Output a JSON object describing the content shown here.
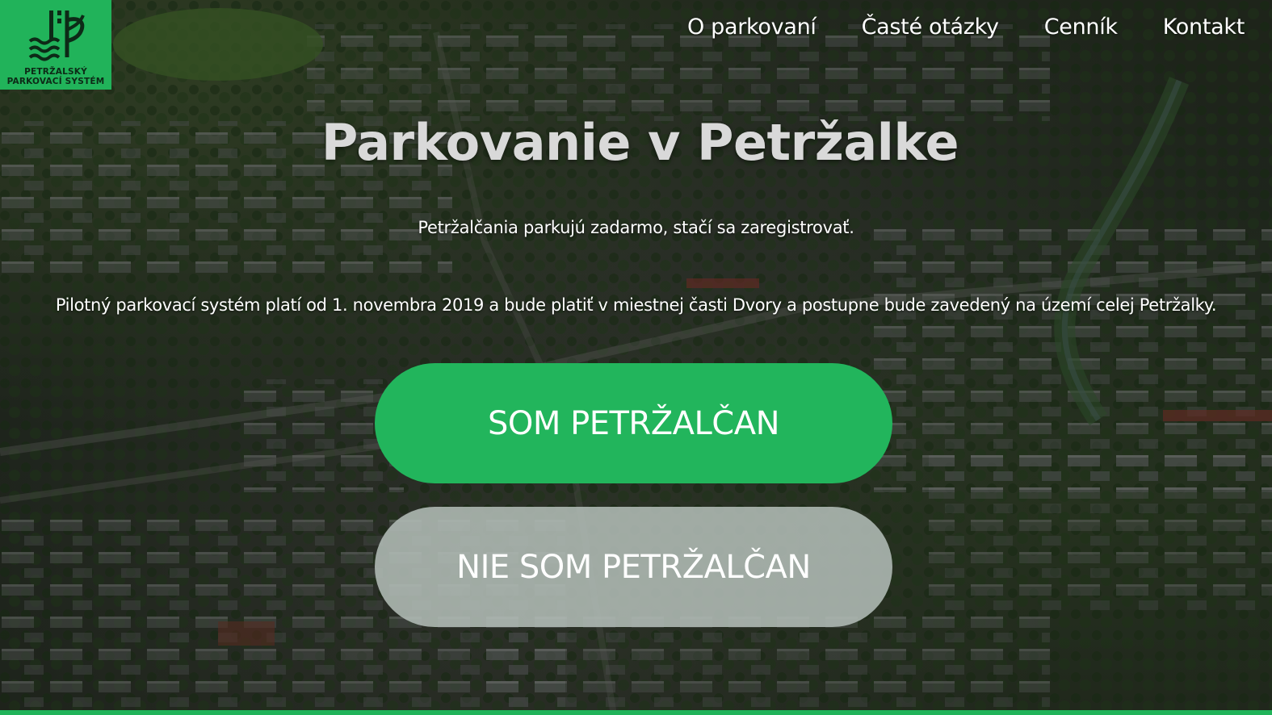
{
  "brand": {
    "logo_line1": "PETRŽALSKÝ",
    "logo_line2": "PARKOVACÍ SYSTÉM",
    "color": "#21b35a"
  },
  "nav": {
    "items": [
      {
        "label": "O parkovaní"
      },
      {
        "label": "Časté otázky"
      },
      {
        "label": "Cenník"
      },
      {
        "label": "Kontakt"
      }
    ]
  },
  "hero": {
    "title": "Parkovanie v Petržalke",
    "subtitle": "Petržalčania parkujú zadarmo, stačí sa zaregistrovať.",
    "note": "Pilotný parkovací systém platí od 1. novembra 2019 a bude platiť v miestnej časti Dvory a postupne bude zavedený na území celej Petržalky.",
    "primary_button": "SOM PETRŽALČAN",
    "secondary_button": "NIE SOM PETRŽALČAN"
  },
  "colors": {
    "primary_button": "#22b55c",
    "secondary_button": "#b2bcb6"
  }
}
